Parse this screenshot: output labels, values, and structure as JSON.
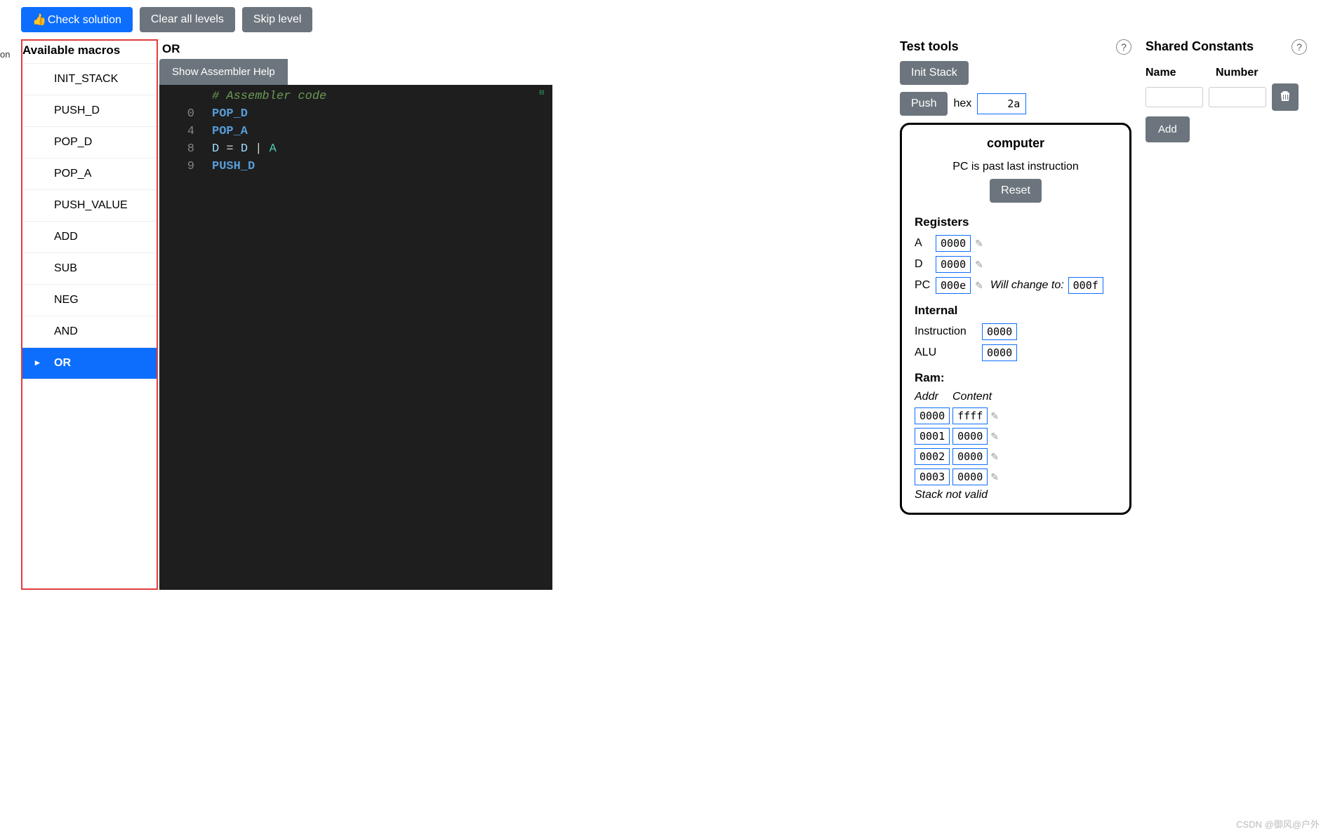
{
  "toolbar": {
    "check_solution": "Check solution",
    "clear_all": "Clear all levels",
    "skip": "Skip level"
  },
  "macros": {
    "title": "Available macros",
    "items": [
      {
        "label": "INIT_STACK"
      },
      {
        "label": "PUSH_D"
      },
      {
        "label": "POP_D"
      },
      {
        "label": "POP_A"
      },
      {
        "label": "PUSH_VALUE"
      },
      {
        "label": "ADD"
      },
      {
        "label": "SUB"
      },
      {
        "label": "NEG"
      },
      {
        "label": "AND"
      },
      {
        "label": "OR"
      }
    ],
    "active_index": 9
  },
  "editor": {
    "title": "OR",
    "help_btn": "Show Assembler Help",
    "lines": [
      {
        "num": "",
        "comment": "# Assembler code"
      },
      {
        "num": "0",
        "kw": "POP_D"
      },
      {
        "num": "4",
        "kw": "POP_A"
      },
      {
        "num": "8",
        "expr": {
          "d1": "D",
          "eq": " = ",
          "d2": "D",
          "pipe": " | ",
          "a": "A"
        }
      },
      {
        "num": "9",
        "kw": "PUSH_D"
      }
    ]
  },
  "test_tools": {
    "title": "Test tools",
    "init_stack": "Init Stack",
    "push": "Push",
    "hex_label": "hex",
    "hex_value": "2a"
  },
  "computer": {
    "title": "computer",
    "pc_msg": "PC is past last instruction",
    "reset": "Reset",
    "registers_title": "Registers",
    "registers": {
      "A": "0000",
      "D": "0000",
      "PC": "000e",
      "will_change": "Will change to:",
      "pc_next": "000f"
    },
    "internal_title": "Internal",
    "internal": {
      "instruction_label": "Instruction",
      "instruction": "0000",
      "alu_label": "ALU",
      "alu": "0000"
    },
    "ram_title": "Ram:",
    "ram_headers": {
      "addr": "Addr",
      "content": "Content"
    },
    "ram": [
      {
        "addr": "0000",
        "content": "ffff"
      },
      {
        "addr": "0001",
        "content": "0000"
      },
      {
        "addr": "0002",
        "content": "0000"
      },
      {
        "addr": "0003",
        "content": "0000"
      }
    ],
    "stack_invalid": "Stack not valid"
  },
  "constants": {
    "title": "Shared Constants",
    "name_label": "Name",
    "number_label": "Number",
    "add": "Add"
  },
  "watermark": "CSDN @御风@户外",
  "left_edge": "on"
}
